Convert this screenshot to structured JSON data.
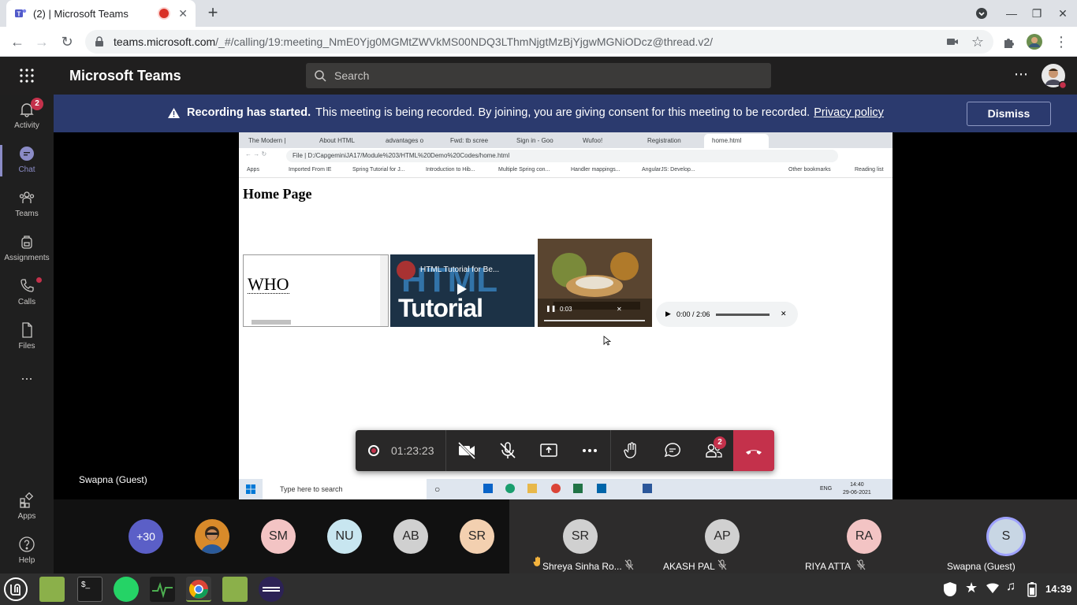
{
  "browser": {
    "tab_title": "(2) | Microsoft Teams",
    "url_host": "teams.microsoft.com",
    "url_path": "/_#/calling/19:meeting_NmE0Yjg0MGMtZWVkMS00NDQ3LThmNjgtMzBjYjgwMGNiODcz@thread.v2/"
  },
  "teams": {
    "app_name": "Microsoft Teams",
    "search_placeholder": "Search"
  },
  "banner": {
    "bold": "Recording has started.",
    "text": "This meeting is being recorded. By joining, you are giving consent for this meeting to be recorded.",
    "link": "Privacy policy",
    "dismiss": "Dismiss"
  },
  "rail": {
    "activity": "Activity",
    "activity_badge": "2",
    "chat": "Chat",
    "teams": "Teams",
    "assignments": "Assignments",
    "calls": "Calls",
    "files": "Files",
    "more": "...",
    "apps": "Apps",
    "help": "Help"
  },
  "shared_screen": {
    "tabs": [
      "The Modern |",
      "About HTML",
      "advantages o",
      "Fwd: tb scree",
      "Sign in - Goo",
      "Wufoo!",
      "Registration",
      "home.html"
    ],
    "address": "File  |  D:/CapgeminiJA17/Module%203/HTML%20Demo%20Codes/home.html",
    "bookmarks": [
      "Apps",
      "Imported From IE",
      "Spring Tutorial for J...",
      "Introduction to Hib...",
      "Multiple Spring con...",
      "Handler mappings...",
      "AngularJS: Develop...",
      "Other bookmarks",
      "Reading list"
    ],
    "page_heading": "Home Page",
    "iframe_text": "WHO",
    "yt_title": "HTML Tutorial for Be...",
    "yt_big": "Tutorial",
    "yt_html": "HTML",
    "video_time": "0:03",
    "audio_time": "0:00 / 2:06",
    "win_search": "Type here to search",
    "win_lang": "ENG",
    "win_time": "14:40",
    "win_date": "29-06-2021"
  },
  "presenter": "Swapna (Guest)",
  "callbar": {
    "timer": "01:23:23",
    "participants_badge": "2"
  },
  "participants": {
    "overflow": "+30",
    "avatars": [
      {
        "initials": "SM",
        "color": "#f3c4c4"
      },
      {
        "initials": "NU",
        "color": "#c8e6f0"
      },
      {
        "initials": "AB",
        "color": "#d0d0d0"
      },
      {
        "initials": "SR",
        "color": "#f3d0b0"
      }
    ],
    "tiles": [
      {
        "initials": "SR",
        "name": "Shreya Sinha Ro...",
        "color": "#d0d0d0"
      },
      {
        "initials": "AP",
        "name": "AKASH PAL",
        "color": "#d0d0d0"
      },
      {
        "initials": "RA",
        "name": "RIYA ATTA",
        "color": "#f3c4c4"
      },
      {
        "initials": "S",
        "name": "Swapna (Guest)",
        "color": "#c8d6e4"
      }
    ]
  },
  "taskbar": {
    "time": "14:39"
  }
}
